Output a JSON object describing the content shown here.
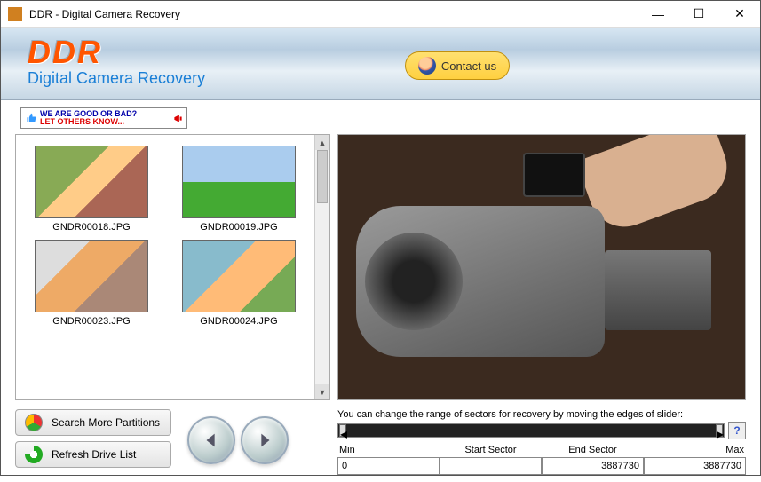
{
  "window": {
    "title": "DDR - Digital Camera Recovery"
  },
  "header": {
    "logo_text": "DDR",
    "subtitle": "Digital Camera Recovery",
    "contact_label": "Contact us"
  },
  "feedback": {
    "line1": "WE ARE GOOD OR BAD?",
    "line2": "LET OTHERS KNOW..."
  },
  "thumbnails": [
    {
      "name": "GNDR00018.JPG"
    },
    {
      "name": "GNDR00019.JPG"
    },
    {
      "name": "GNDR00023.JPG"
    },
    {
      "name": "GNDR00024.JPG"
    }
  ],
  "buttons": {
    "search_partitions": "Search More Partitions",
    "refresh_drives": "Refresh Drive List"
  },
  "slider": {
    "instruction": "You can change the range of sectors for recovery by moving the edges of slider:",
    "min_label": "Min",
    "start_label": "Start Sector",
    "end_label": "End Sector",
    "max_label": "Max",
    "min_value": "0",
    "start_value": "",
    "end_value": "3887730",
    "max_value": "3887730",
    "help": "?"
  }
}
